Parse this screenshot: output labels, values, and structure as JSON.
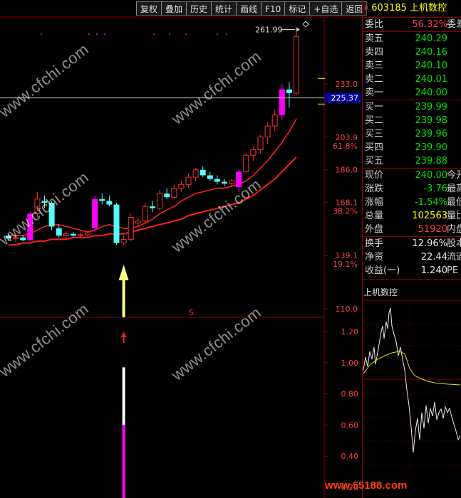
{
  "toolbar": {
    "buttons": [
      "复权",
      "叠加",
      "历史",
      "统计",
      "画线",
      "F10",
      "标记",
      "+自选",
      "返回"
    ]
  },
  "stock": {
    "marker": "R",
    "code": "603185",
    "name": "上机数控"
  },
  "quote_rows_top": [
    {
      "label": "委比",
      "value": "56.32%",
      "value_color": "red",
      "tail": "委差"
    }
  ],
  "order_book": {
    "sell": [
      {
        "label": "卖五",
        "price": "240.29"
      },
      {
        "label": "卖四",
        "price": "240.16"
      },
      {
        "label": "卖三",
        "price": "240.10"
      },
      {
        "label": "卖二",
        "price": "240.01"
      },
      {
        "label": "卖一",
        "price": "240.00"
      }
    ],
    "buy": [
      {
        "label": "买一",
        "price": "239.99"
      },
      {
        "label": "买二",
        "price": "239.98"
      },
      {
        "label": "买三",
        "price": "239.96"
      },
      {
        "label": "买四",
        "price": "239.90"
      },
      {
        "label": "买五",
        "price": "239.88"
      }
    ]
  },
  "stats": [
    {
      "label": "现价",
      "value": "240.00",
      "value_color": "green",
      "tail": "今开"
    },
    {
      "label": "涨跌",
      "value": "-3.76",
      "value_color": "green",
      "tail": "最高"
    },
    {
      "label": "涨幅",
      "value": "-1.54%",
      "value_color": "green",
      "tail": "最低"
    },
    {
      "label": "总量",
      "value": "102563",
      "value_color": "yellow",
      "tail": "量比"
    },
    {
      "label": "外盘",
      "value": "51920",
      "value_color": "red",
      "tail": "内盘"
    }
  ],
  "stats2": [
    {
      "label": "换手",
      "value": "12.96%",
      "tail": "股本"
    },
    {
      "label": "净资",
      "value": "22.44",
      "tail": "流通"
    },
    {
      "label": "收益(一)",
      "value": "1.240",
      "tail": "PE"
    }
  ],
  "mini_chart_title": "上机数控",
  "price_axis": {
    "ticks": [
      {
        "price": 233.0,
        "label": "233.0",
        "pct": ""
      },
      {
        "price": 203.9,
        "label": "203.9",
        "pct": "61.8%"
      },
      {
        "price": 186.0,
        "label": "186.0",
        "pct": ""
      },
      {
        "price": 168.1,
        "label": "168.1",
        "pct": "38.2%"
      },
      {
        "price": 139.1,
        "label": "139.1",
        "pct": "19.1%"
      },
      {
        "price": 110.0,
        "label": "110.0",
        "pct": ""
      }
    ],
    "current_price_tag": "225.37",
    "high_label": "261.99"
  },
  "indicator_axis": {
    "ticks": [
      "1.20",
      "1.00",
      "0.80",
      "0.60",
      "0.40",
      "0.20"
    ]
  },
  "signal_mark": "S",
  "colors": {
    "up": "#ff3030",
    "down": "#54fcfc",
    "signal": "#ff00ff",
    "ma": "#ff2020",
    "arrow": "#ffff80",
    "grid": "#8a0000"
  },
  "watermarks": [
    "www.cfchi.com"
  ],
  "site_logo": "www.55188.com",
  "chart_data": {
    "type": "candlestick",
    "candles": [
      {
        "o": 150.0,
        "h": 151.0,
        "l": 147.0,
        "c": 148.5
      },
      {
        "o": 148.5,
        "h": 150.0,
        "l": 146.5,
        "c": 149.0
      },
      {
        "o": 149.0,
        "h": 150.5,
        "l": 147.0,
        "c": 147.5
      },
      {
        "o": 147.5,
        "h": 163.0,
        "l": 147.0,
        "c": 162.0
      },
      {
        "o": 162.0,
        "h": 174.0,
        "l": 160.0,
        "c": 170.0
      },
      {
        "o": 169.0,
        "h": 172.0,
        "l": 165.0,
        "c": 168.0
      },
      {
        "o": 168.0,
        "h": 169.0,
        "l": 153.0,
        "c": 155.0
      },
      {
        "o": 154.0,
        "h": 156.0,
        "l": 149.0,
        "c": 150.0
      },
      {
        "o": 150.0,
        "h": 152.5,
        "l": 148.0,
        "c": 151.0
      },
      {
        "o": 151.0,
        "h": 152.0,
        "l": 149.5,
        "c": 150.0
      },
      {
        "o": 150.0,
        "h": 151.5,
        "l": 149.0,
        "c": 150.5
      },
      {
        "o": 150.5,
        "h": 152.0,
        "l": 149.5,
        "c": 151.5
      },
      {
        "o": 154.0,
        "h": 172.0,
        "l": 152.0,
        "c": 170.0
      },
      {
        "o": 170.0,
        "h": 173.0,
        "l": 167.0,
        "c": 169.0
      },
      {
        "o": 169.0,
        "h": 172.0,
        "l": 166.0,
        "c": 167.0
      },
      {
        "o": 167.0,
        "h": 168.0,
        "l": 145.0,
        "c": 146.0
      },
      {
        "o": 146.0,
        "h": 150.0,
        "l": 145.0,
        "c": 148.0
      },
      {
        "o": 148.0,
        "h": 162.0,
        "l": 147.0,
        "c": 160.0
      },
      {
        "o": 157.0,
        "h": 160.0,
        "l": 155.0,
        "c": 158.0
      },
      {
        "o": 158.0,
        "h": 168.0,
        "l": 157.0,
        "c": 166.0
      },
      {
        "o": 166.0,
        "h": 169.0,
        "l": 163.0,
        "c": 165.0
      },
      {
        "o": 165.0,
        "h": 175.0,
        "l": 164.0,
        "c": 173.0
      },
      {
        "o": 173.0,
        "h": 176.0,
        "l": 170.0,
        "c": 171.0
      },
      {
        "o": 171.0,
        "h": 178.0,
        "l": 170.0,
        "c": 176.0
      },
      {
        "o": 176.0,
        "h": 180.0,
        "l": 174.0,
        "c": 178.0
      },
      {
        "o": 178.0,
        "h": 184.0,
        "l": 176.0,
        "c": 182.0
      },
      {
        "o": 182.0,
        "h": 187.0,
        "l": 180.0,
        "c": 186.0
      },
      {
        "o": 186.0,
        "h": 188.0,
        "l": 182.0,
        "c": 183.0
      },
      {
        "o": 183.0,
        "h": 185.0,
        "l": 180.0,
        "c": 181.0
      },
      {
        "o": 181.0,
        "h": 183.0,
        "l": 178.0,
        "c": 179.5
      },
      {
        "o": 179.5,
        "h": 181.0,
        "l": 177.0,
        "c": 178.5
      },
      {
        "o": 178.5,
        "h": 181.0,
        "l": 177.0,
        "c": 180.0
      },
      {
        "o": 176.5,
        "h": 186.0,
        "l": 174.0,
        "c": 185.0
      },
      {
        "o": 185.0,
        "h": 195.0,
        "l": 184.0,
        "c": 194.0
      },
      {
        "o": 194.0,
        "h": 199.0,
        "l": 191.0,
        "c": 197.0
      },
      {
        "o": 197.0,
        "h": 205.0,
        "l": 195.0,
        "c": 204.0
      },
      {
        "o": 204.0,
        "h": 212.0,
        "l": 200.0,
        "c": 210.0
      },
      {
        "o": 210.0,
        "h": 219.0,
        "l": 207.0,
        "c": 216.0
      },
      {
        "o": 216.0,
        "h": 233.0,
        "l": 213.0,
        "c": 230.0
      },
      {
        "o": 230.0,
        "h": 234.0,
        "l": 220.0,
        "c": 228.0
      },
      {
        "o": 228.0,
        "h": 262.0,
        "l": 227.0,
        "c": 259.0
      }
    ],
    "signal_bars": [
      3,
      12,
      32,
      38
    ],
    "ma_short": [
      150,
      150,
      150,
      151,
      153,
      155,
      156,
      156,
      155,
      154,
      153,
      152,
      153,
      155,
      156,
      155,
      154,
      154,
      155,
      157,
      159,
      162,
      164,
      166,
      169,
      171,
      173,
      174,
      175,
      176,
      176,
      177,
      178,
      180,
      183,
      187,
      191,
      196,
      201,
      207,
      214
    ],
    "ma_long": [
      145,
      145,
      146,
      146,
      147,
      147,
      148,
      148,
      148,
      149,
      149,
      149,
      150,
      150,
      151,
      151,
      151,
      152,
      153,
      154,
      155,
      156,
      157,
      158,
      159,
      161,
      162,
      163,
      164,
      165,
      166,
      167,
      168,
      170,
      172,
      175,
      178,
      181,
      185,
      189,
      193
    ],
    "indicator": [
      0.2,
      0.2,
      0.2,
      0.2,
      0.2,
      0.2,
      0.2,
      0.2,
      0.2,
      0.2,
      0.2,
      0.2,
      0.2,
      0.2,
      0.2,
      0.2,
      0.97,
      0.2
    ]
  }
}
